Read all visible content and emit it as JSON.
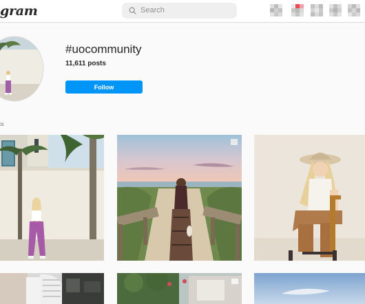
{
  "header": {
    "logo_text": "gram",
    "search_placeholder": "Search"
  },
  "nav_icons": [
    "home-icon",
    "direct-icon",
    "new-post-icon",
    "explore-icon",
    "activity-icon",
    "profile-icon"
  ],
  "profile": {
    "hashtag": "#uocommunity",
    "post_count": "11,611 posts",
    "follow_label": "Follow"
  },
  "section": {
    "label": "sts"
  },
  "colors": {
    "accent": "#0095f6",
    "background": "#fafafa",
    "border": "#dbdbdb",
    "notification": "#ed4956"
  }
}
